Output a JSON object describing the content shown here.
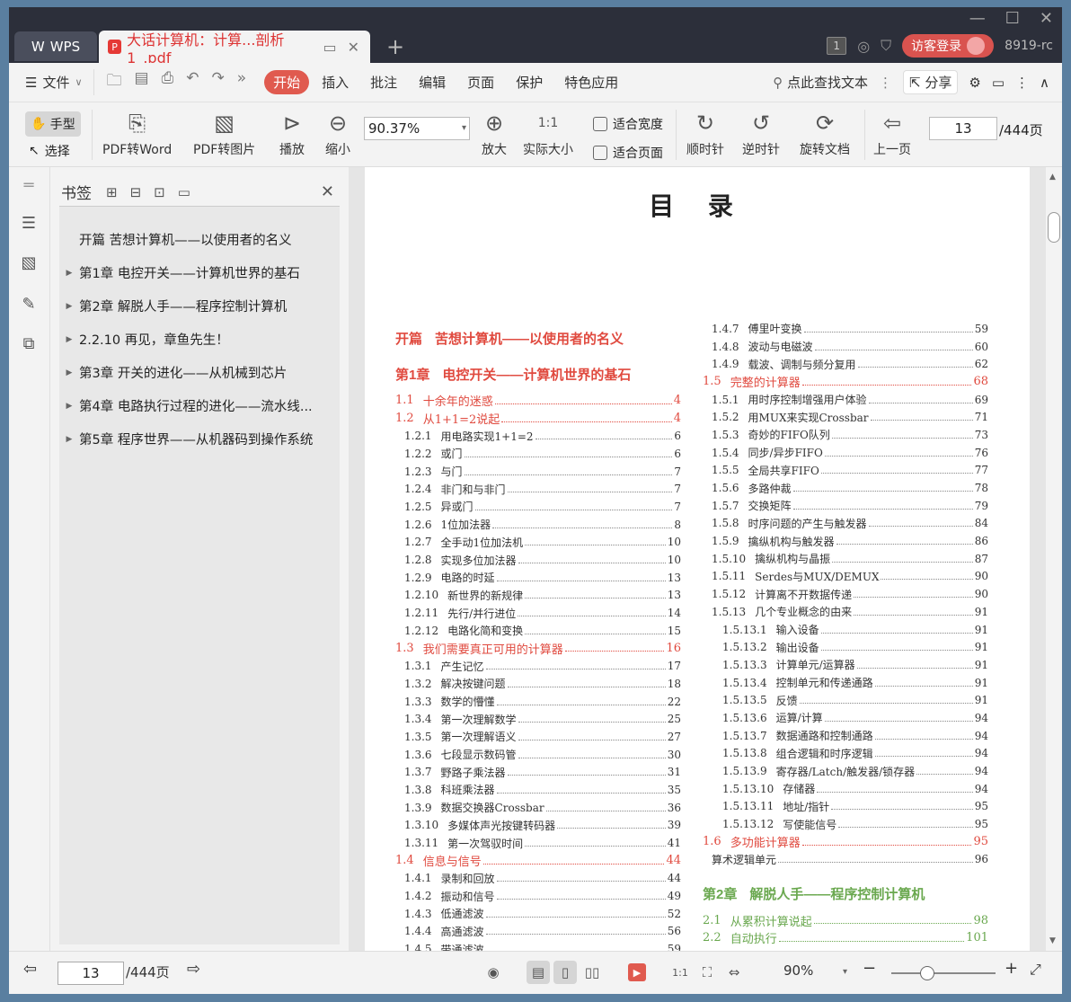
{
  "titlebar": {
    "app_tab": "WPS",
    "doc_tab": "大话计算机：计算...剖析1_.pdf",
    "page_badge": "1",
    "login": "访客登录",
    "user": "8919-rc"
  },
  "menubar": {
    "file": "文件",
    "tabs": [
      "开始",
      "插入",
      "批注",
      "编辑",
      "页面",
      "保护",
      "特色应用"
    ],
    "search": "点此查找文本",
    "share": "分享"
  },
  "ribbon": {
    "hand": "手型",
    "select": "选择",
    "pdf_word": "PDF转Word",
    "pdf_img": "PDF转图片",
    "play": "播放",
    "zoom_out": "缩小",
    "zoom_value": "90.37%",
    "zoom_in": "放大",
    "actual_size": "实际大小",
    "fit_width": "适合宽度",
    "fit_page": "适合页面",
    "cw": "顺时针",
    "ccw": "逆时针",
    "rotate_doc": "旋转文档",
    "prev_page": "上一页",
    "page_current": "13",
    "page_total": "/444页"
  },
  "bookmark": {
    "title": "书签",
    "items": [
      {
        "label": "开篇  苦想计算机——以使用者的名义",
        "arrow": false
      },
      {
        "label": "第1章  电控开关——计算机世界的基石",
        "arrow": true
      },
      {
        "label": "第2章  解脱人手——程序控制计算机",
        "arrow": true
      },
      {
        "label": "2.2.10  再见，章鱼先生！",
        "arrow": true
      },
      {
        "label": "第3章  开关的进化——从机械到芯片",
        "arrow": true
      },
      {
        "label": "第4章  电路执行过程的进化——流水线...",
        "arrow": true
      },
      {
        "label": "第5章  程序世界——从机器码到操作系统",
        "arrow": true
      }
    ]
  },
  "document": {
    "title": "目  录",
    "left": [
      {
        "k": "chap",
        "n": "开篇",
        "t": "苦想计算机——以使用者的名义"
      },
      {
        "k": "chap",
        "n": "第1章",
        "t": "电控开关——计算机世界的基石"
      },
      {
        "k": "sec",
        "n": "1.1",
        "t": "十余年的迷惑",
        "p": "4"
      },
      {
        "k": "sec",
        "n": "1.2",
        "t": "从1+1=2说起",
        "p": "4"
      },
      {
        "k": "sub",
        "n": "1.2.1",
        "t": "用电路实现1+1=2",
        "p": "6"
      },
      {
        "k": "sub",
        "n": "1.2.2",
        "t": "或门",
        "p": "6"
      },
      {
        "k": "sub",
        "n": "1.2.3",
        "t": "与门",
        "p": "7"
      },
      {
        "k": "sub",
        "n": "1.2.4",
        "t": "非门和与非门",
        "p": "7"
      },
      {
        "k": "sub",
        "n": "1.2.5",
        "t": "异或门",
        "p": "7"
      },
      {
        "k": "sub",
        "n": "1.2.6",
        "t": "1位加法器",
        "p": "8"
      },
      {
        "k": "sub",
        "n": "1.2.7",
        "t": "全手动1位加法机",
        "p": "10"
      },
      {
        "k": "sub",
        "n": "1.2.8",
        "t": "实现多位加法器",
        "p": "10"
      },
      {
        "k": "sub",
        "n": "1.2.9",
        "t": "电路的时延",
        "p": "13"
      },
      {
        "k": "sub",
        "n": "1.2.10",
        "t": "新世界的新规律",
        "p": "13"
      },
      {
        "k": "sub",
        "n": "1.2.11",
        "t": "先行/并行进位",
        "p": "14"
      },
      {
        "k": "sub",
        "n": "1.2.12",
        "t": "电路化简和变换",
        "p": "15"
      },
      {
        "k": "sec",
        "n": "1.3",
        "t": "我们需要真正可用的计算器",
        "p": "16"
      },
      {
        "k": "sub",
        "n": "1.3.1",
        "t": "产生记忆",
        "p": "17"
      },
      {
        "k": "sub",
        "n": "1.3.2",
        "t": "解决按键问题",
        "p": "18"
      },
      {
        "k": "sub",
        "n": "1.3.3",
        "t": "数学的懵懂",
        "p": "22"
      },
      {
        "k": "sub",
        "n": "1.3.4",
        "t": "第一次理解数学",
        "p": "25"
      },
      {
        "k": "sub",
        "n": "1.3.5",
        "t": "第一次理解语义",
        "p": "27"
      },
      {
        "k": "sub",
        "n": "1.3.6",
        "t": "七段显示数码管",
        "p": "30"
      },
      {
        "k": "sub",
        "n": "1.3.7",
        "t": "野路子乘法器",
        "p": "31"
      },
      {
        "k": "sub",
        "n": "1.3.8",
        "t": "科班乘法器",
        "p": "35"
      },
      {
        "k": "sub",
        "n": "1.3.9",
        "t": "数据交换器Crossbar",
        "p": "36"
      },
      {
        "k": "sub",
        "n": "1.3.10",
        "t": "多媒体声光按键转码器",
        "p": "39"
      },
      {
        "k": "sub",
        "n": "1.3.11",
        "t": "第一次驾驭时间",
        "p": "41"
      },
      {
        "k": "sec",
        "n": "1.4",
        "t": "信息与信号",
        "p": "44"
      },
      {
        "k": "sub",
        "n": "1.4.1",
        "t": "录制和回放",
        "p": "44"
      },
      {
        "k": "sub",
        "n": "1.4.2",
        "t": "振动和信号",
        "p": "49"
      },
      {
        "k": "sub",
        "n": "1.4.3",
        "t": "低通滤波",
        "p": "52"
      },
      {
        "k": "sub",
        "n": "1.4.4",
        "t": "高通滤波",
        "p": "56"
      },
      {
        "k": "sub",
        "n": "1.4.5",
        "t": "带通滤波",
        "p": "59"
      }
    ],
    "right": [
      {
        "k": "sub",
        "n": "1.4.7",
        "t": "傅里叶变换",
        "p": "59"
      },
      {
        "k": "sub",
        "n": "1.4.8",
        "t": "波动与电磁波",
        "p": "60"
      },
      {
        "k": "sub",
        "n": "1.4.9",
        "t": "载波、调制与频分复用",
        "p": "62"
      },
      {
        "k": "sec",
        "n": "1.5",
        "t": "完整的计算器",
        "p": "68"
      },
      {
        "k": "sub",
        "n": "1.5.1",
        "t": "用时序控制增强用户体验",
        "p": "69"
      },
      {
        "k": "sub",
        "n": "1.5.2",
        "t": "用MUX来实现Crossbar",
        "p": "71"
      },
      {
        "k": "sub",
        "n": "1.5.3",
        "t": "奇妙的FIFO队列",
        "p": "73"
      },
      {
        "k": "sub",
        "n": "1.5.4",
        "t": "同步/异步FIFO",
        "p": "76"
      },
      {
        "k": "sub",
        "n": "1.5.5",
        "t": "全局共享FIFO",
        "p": "77"
      },
      {
        "k": "sub",
        "n": "1.5.6",
        "t": "多路仲裁",
        "p": "78"
      },
      {
        "k": "sub",
        "n": "1.5.7",
        "t": "交换矩阵",
        "p": "79"
      },
      {
        "k": "sub",
        "n": "1.5.8",
        "t": "时序问题的产生与触发器",
        "p": "84"
      },
      {
        "k": "sub",
        "n": "1.5.9",
        "t": "擒纵机构与触发器",
        "p": "86"
      },
      {
        "k": "sub",
        "n": "1.5.10",
        "t": "擒纵机构与晶振",
        "p": "87"
      },
      {
        "k": "sub",
        "n": "1.5.11",
        "t": "Serdes与MUX/DEMUX",
        "p": "90"
      },
      {
        "k": "sub",
        "n": "1.5.12",
        "t": "计算离不开数据传递",
        "p": "90"
      },
      {
        "k": "sub",
        "n": "1.5.13",
        "t": "几个专业概念的由来",
        "p": "91"
      },
      {
        "k": "sub3",
        "n": "1.5.13.1",
        "t": "输入设备",
        "p": "91"
      },
      {
        "k": "sub3",
        "n": "1.5.13.2",
        "t": "输出设备",
        "p": "91"
      },
      {
        "k": "sub3",
        "n": "1.5.13.3",
        "t": "计算单元/运算器",
        "p": "91"
      },
      {
        "k": "sub3",
        "n": "1.5.13.4",
        "t": "控制单元和传递通路",
        "p": "91"
      },
      {
        "k": "sub3",
        "n": "1.5.13.5",
        "t": "反馈",
        "p": "91"
      },
      {
        "k": "sub3",
        "n": "1.5.13.6",
        "t": "运算/计算",
        "p": "94"
      },
      {
        "k": "sub3",
        "n": "1.5.13.7",
        "t": "数据通路和控制通路",
        "p": "94"
      },
      {
        "k": "sub3",
        "n": "1.5.13.8",
        "t": "组合逻辑和时序逻辑",
        "p": "94"
      },
      {
        "k": "sub3",
        "n": "1.5.13.9",
        "t": "寄存器/Latch/触发器/锁存器",
        "p": "94"
      },
      {
        "k": "sub3",
        "n": "1.5.13.10",
        "t": "存储器",
        "p": "94"
      },
      {
        "k": "sub3",
        "n": "1.5.13.11",
        "t": "地址/指针",
        "p": "95"
      },
      {
        "k": "sub3",
        "n": "1.5.13.12",
        "t": "写使能信号",
        "p": "95"
      },
      {
        "k": "sec",
        "n": "1.6",
        "t": "多功能计算器",
        "p": "95"
      },
      {
        "k": "plain",
        "n": "",
        "t": "算术逻辑单元",
        "p": "96"
      },
      {
        "k": "gap"
      },
      {
        "k": "chapg",
        "n": "第2章",
        "t": "解脱人手——程序控制计算机"
      },
      {
        "k": "gsec",
        "n": "2.1",
        "t": "从累积计算说起",
        "p": "98"
      },
      {
        "k": "gsec",
        "n": "2.2",
        "t": "自动执行",
        "p": "101"
      }
    ]
  },
  "statusbar": {
    "page_current": "13",
    "page_total": "/444页",
    "zoom": "90%",
    "zoom_fraction": 0.4
  },
  "colors": {
    "accent": "#e05a4f",
    "toc_red": "#e04a3f",
    "toc_green": "#6aa84f"
  }
}
